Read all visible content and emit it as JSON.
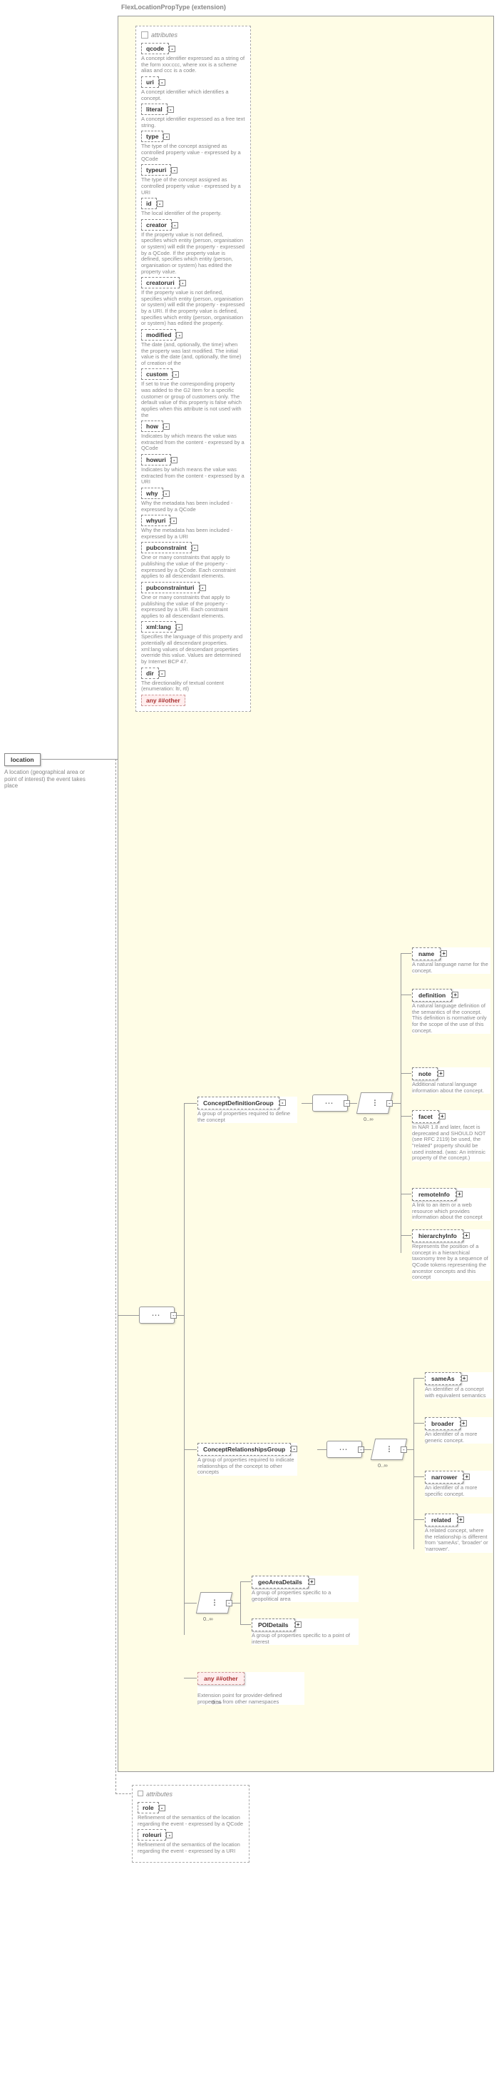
{
  "type_header": "FlexLocationPropType (extension)",
  "root": {
    "name": "location",
    "desc": "A location (geographical area or point of interest) the event takes place"
  },
  "attrs_header": "attributes",
  "top_attrs": [
    {
      "name": "qcode",
      "desc": "A concept identifier expressed as a string of the form xxx:ccc, where xxx is a scheme alias and ccc is a code."
    },
    {
      "name": "uri",
      "desc": "A concept identifier which identifies a concept."
    },
    {
      "name": "literal",
      "desc": "A concept identifier expressed as a free text string."
    },
    {
      "name": "type",
      "desc": "The type of the concept assigned as controlled property value - expressed by a QCode"
    },
    {
      "name": "typeuri",
      "desc": "The type of the concept assigned as controlled property value - expressed by a URI"
    },
    {
      "name": "id",
      "desc": "The local identifier of the property."
    },
    {
      "name": "creator",
      "desc": "If the property value is not defined, specifies which entity (person, organisation or system) will edit the property - expressed by a QCode. If the property value is defined, specifies which entity (person, organisation or system) has edited the property value."
    },
    {
      "name": "creatoruri",
      "desc": "If the property value is not defined, specifies which entity (person, organisation or system) will edit the property - expressed by a URI. If the property value is defined, specifies which entity (person, organisation or system) has edited the property."
    },
    {
      "name": "modified",
      "desc": "The date (and, optionally, the time) when the property was last modified. The initial value is the date (and, optionally, the time) of creation of the"
    },
    {
      "name": "custom",
      "desc": "If set to true the corresponding property was added to the G2 Item for a specific customer or group of customers only. The default value of this property is false which applies when this attribute is not used with the"
    },
    {
      "name": "how",
      "desc": "Indicates by which means the value was extracted from the content - expressed by a QCode"
    },
    {
      "name": "howuri",
      "desc": "Indicates by which means the value was extracted from the content - expressed by a URI"
    },
    {
      "name": "why",
      "desc": "Why the metadata has been included - expressed by a QCode"
    },
    {
      "name": "whyuri",
      "desc": "Why the metadata has been included - expressed by a URI"
    },
    {
      "name": "pubconstraint",
      "desc": "One or many constraints that apply to publishing the value of the property - expressed by a QCode. Each constraint applies to all descendant elements."
    },
    {
      "name": "pubconstrainturi",
      "desc": "One or many constraints that apply to publishing the value of the property - expressed by a URI. Each constraint applies to all descendant elements."
    },
    {
      "name": "xml:lang",
      "desc": "Specifies the language of this property and potentially all descendant properties. xml:lang values of descendant properties override this value. Values are determined by Internet BCP 47."
    },
    {
      "name": "dir",
      "desc": "The directionality of textual content (enumeration: ltr, rtl)"
    }
  ],
  "any_other": "any ##other",
  "groups": {
    "cdg": {
      "name": "ConceptDefinitionGroup",
      "desc": "A group of properties required to define the concept"
    },
    "crg": {
      "name": "ConceptRelationshipsGroup",
      "desc": "A group of properties required to indicate relationships of the concept to other concepts"
    }
  },
  "cdg_elements": [
    {
      "name": "name",
      "desc": "A natural language name for the concept."
    },
    {
      "name": "definition",
      "desc": "A natural language definition of the semantics of the concept. This definition is normative only for the scope of the use of this concept."
    },
    {
      "name": "note",
      "desc": "Additional natural language information about the concept."
    },
    {
      "name": "facet",
      "desc": "In NAR 1.8 and later, facet is deprecated and SHOULD NOT (see RFC 2119) be used, the \"related\" property should be used instead. (was: An intrinsic property of the concept.)"
    },
    {
      "name": "remoteInfo",
      "desc": "A link to an item or a web resource which provides information about the concept"
    },
    {
      "name": "hierarchyInfo",
      "desc": "Represents the position of a concept in a hierarchical taxonomy tree by a sequence of QCode tokens representing the ancestor concepts and this concept"
    }
  ],
  "crg_elements": [
    {
      "name": "sameAs",
      "desc": "An identifier of a concept with equivalent semantics"
    },
    {
      "name": "broader",
      "desc": "An identifier of a more generic concept."
    },
    {
      "name": "narrower",
      "desc": "An identifier of a more specific concept."
    },
    {
      "name": "related",
      "desc": "A related concept, where the relationship is different from 'sameAs', 'broader' or 'narrower'."
    }
  ],
  "bottom_elements": [
    {
      "name": "geoAreaDetails",
      "desc": "A group of properties specific to a geopolitical area"
    },
    {
      "name": "POIDetails",
      "desc": "A group of properties specific to a point of interest"
    }
  ],
  "any_other_el": {
    "label": "any ##other",
    "desc": "Extension point for provider-defined properties from other namespaces"
  },
  "occurs": "0..∞",
  "bottom_attrs": [
    {
      "name": "role",
      "desc": "Refinement of the semantics of the location regarding the event - expressed by a QCode"
    },
    {
      "name": "roleuri",
      "desc": "Refinement of the semantics of the location regarding the event - expressed by a URI"
    }
  ]
}
